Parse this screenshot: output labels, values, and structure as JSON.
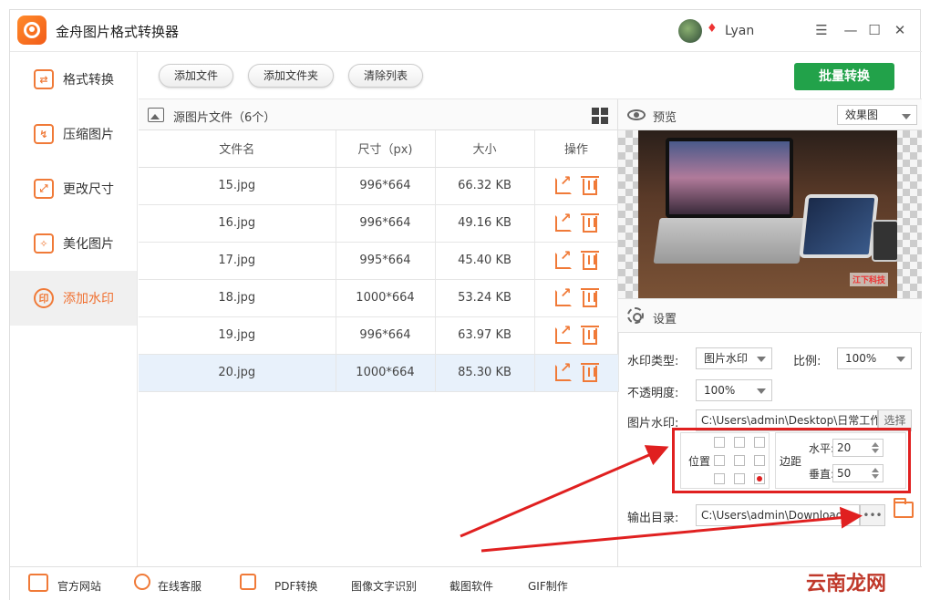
{
  "app": {
    "title": "金舟图片格式转换器",
    "user": "Lyan"
  },
  "window_controls": {
    "menu": "☰",
    "minimize": "—",
    "maximize": "☐",
    "close": "✕"
  },
  "sidebar": {
    "items": [
      {
        "label": "格式转换",
        "icon": "convert-icon"
      },
      {
        "label": "压缩图片",
        "icon": "compress-icon"
      },
      {
        "label": "更改尺寸",
        "icon": "resize-icon"
      },
      {
        "label": "美化图片",
        "icon": "beautify-icon"
      },
      {
        "label": "添加水印",
        "icon": "watermark-icon",
        "active": true
      }
    ]
  },
  "toolbar": {
    "add_file": "添加文件",
    "add_folder": "添加文件夹",
    "clear_list": "清除列表",
    "batch_convert": "批量转换"
  },
  "file_panel": {
    "title": "源图片文件（6个）",
    "columns": [
      "文件名",
      "尺寸（px)",
      "大小",
      "操作"
    ],
    "rows": [
      {
        "name": "15.jpg",
        "size": "996*664",
        "filesize": "66.32 KB"
      },
      {
        "name": "16.jpg",
        "size": "996*664",
        "filesize": "49.16 KB"
      },
      {
        "name": "17.jpg",
        "size": "995*664",
        "filesize": "45.40 KB"
      },
      {
        "name": "18.jpg",
        "size": "1000*664",
        "filesize": "53.24 KB"
      },
      {
        "name": "19.jpg",
        "size": "996*664",
        "filesize": "63.97 KB"
      },
      {
        "name": "20.jpg",
        "size": "1000*664",
        "filesize": "85.30 KB",
        "selected": true
      }
    ]
  },
  "preview": {
    "title": "预览",
    "mode": "效果图",
    "watermark_text": "江下科技"
  },
  "settings": {
    "title": "设置",
    "watermark_type_label": "水印类型:",
    "watermark_type": "图片水印",
    "ratio_label": "比例:",
    "ratio": "100%",
    "opacity_label": "不透明度:",
    "opacity": "100%",
    "image_wm_label": "图片水印:",
    "image_wm_path": "C:\\Users\\admin\\Desktop\\日常工作",
    "choose": "选择",
    "position_label": "位置",
    "margin_label": "边距",
    "horizontal_label": "水平:",
    "horizontal": "20",
    "vertical_label": "垂直:",
    "vertical": "50",
    "output_label": "输出目录:",
    "output_path": "C:\\Users\\admin\\Downloads",
    "more": "•••"
  },
  "footer": {
    "items": [
      "官方网站",
      "在线客服",
      "PDF转换",
      "图像文字识别",
      "截图软件",
      "GIF制作"
    ]
  },
  "site_mark": "云南龙网",
  "colors": {
    "accent": "#f07a38",
    "green": "#22a24a",
    "annotation_red": "#e02020"
  }
}
